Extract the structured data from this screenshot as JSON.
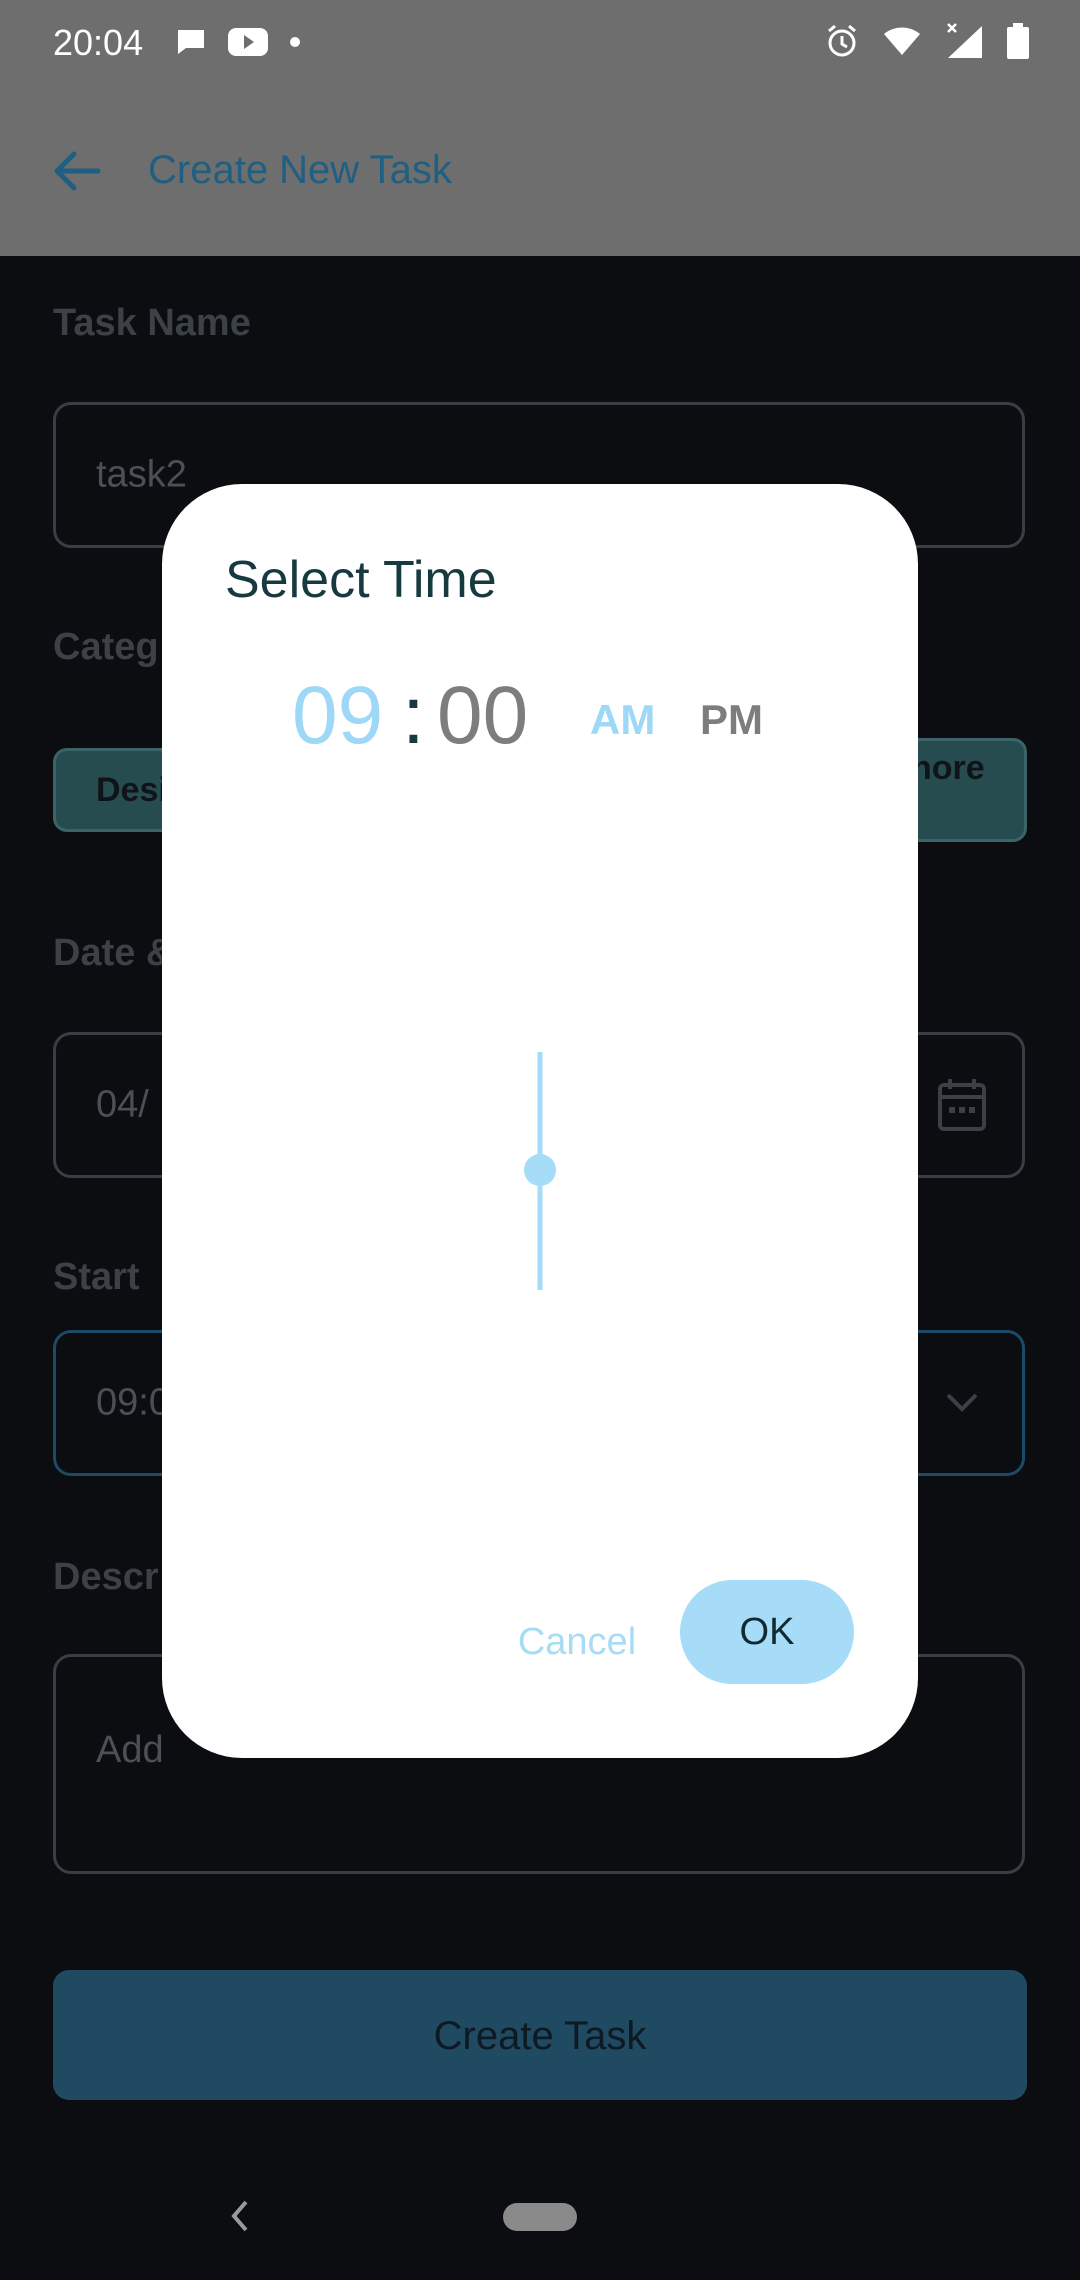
{
  "status_bar": {
    "time": "20:04",
    "left_icons": [
      "chat-bubble-icon",
      "youtube-icon",
      "dot-icon"
    ],
    "right_icons": [
      "alarm-icon",
      "wifi-icon",
      "signal-icon",
      "battery-icon"
    ]
  },
  "app_bar": {
    "back_icon": "arrow-left-icon",
    "title": "Create New Task"
  },
  "form": {
    "task_name_label": "Task Name",
    "task_name_value": "task2",
    "category_label": "Categ",
    "category_chip_left": "Desi",
    "category_chip_right": "nore",
    "date_label": "Date &",
    "date_value": "04/",
    "date_icon": "calendar-icon",
    "start_label": "Start",
    "start_value": "09:0",
    "start_icon": "chevron-down-icon",
    "description_label": "Descr",
    "description_placeholder": "Add",
    "submit_label": "Create Task"
  },
  "dialog": {
    "title": "Select Time",
    "hour": "09",
    "separator": ":",
    "minute": "00",
    "am_label": "AM",
    "pm_label": "PM",
    "selected_period": "AM",
    "cancel_label": "Cancel",
    "ok_label": "OK"
  },
  "colors": {
    "accent": "#9DD8F6",
    "dialog_title": "#163A3F",
    "appbar_title": "#1F5F82",
    "background": "#0B0D10"
  },
  "nav_bar": {
    "back_icon": "nav-back-icon",
    "home_icon": "nav-home-pill"
  }
}
